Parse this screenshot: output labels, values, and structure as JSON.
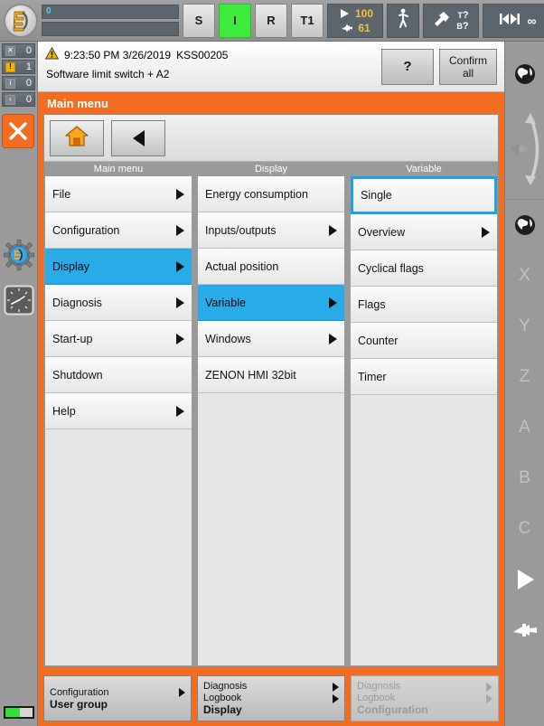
{
  "statusbar": {
    "robot_icon": "kuka-robot-icon",
    "field_top_value": "0",
    "field_bottom_value": "",
    "mode_buttons": [
      {
        "label": "S",
        "active": false
      },
      {
        "label": "I",
        "active": true
      },
      {
        "label": "R",
        "active": false
      },
      {
        "label": "T1",
        "active": false
      }
    ],
    "speed": {
      "program_override": "100",
      "jog_override": "61",
      "program_icon": "play-icon",
      "jog_icon": "hand-icon"
    },
    "walk_icon": "walking-person-icon",
    "tool_base": {
      "icon": "tool-icon",
      "tool_label": "T",
      "tool_value": "?",
      "base_label": "B",
      "base_value": "?"
    },
    "increment_icon": "increment-jog-icon",
    "increment_value": "∞"
  },
  "message": {
    "warning_icon": "warning-triangle-icon",
    "timestamp": "9:23:50 PM 3/26/2019",
    "code": "KSS00205",
    "text": "Software limit switch + A2",
    "help_button": "?",
    "confirm_button": "Confirm all"
  },
  "left_rail": {
    "counters": [
      {
        "icon": "ack-message-icon",
        "value": "0"
      },
      {
        "icon": "warning-icon",
        "value": "1"
      },
      {
        "icon": "info-icon",
        "value": "0"
      },
      {
        "icon": "wait-icon",
        "value": "0"
      }
    ],
    "stop_button": "stop-x-button",
    "gear_icon": "robot-config-gear-icon",
    "clock_icon": "clock-icon",
    "battery_icon": "battery-icon"
  },
  "right_rail": {
    "top": {
      "globe_icon": "world-globe-icon",
      "jog_arrows_icon": "jog-rotate-arrows-icon"
    },
    "bottom": {
      "globe_icon": "world-globe-icon",
      "axes": [
        "X",
        "Y",
        "Z",
        "A",
        "B",
        "C"
      ],
      "play_icon": "play-triangle-icon",
      "hand_icon": "hand-jog-icon"
    }
  },
  "panel": {
    "title": "Main menu",
    "nav": {
      "home_button": "home-icon",
      "back_button": "back-arrow-icon"
    },
    "columns": [
      {
        "header": "Main menu",
        "items": [
          {
            "label": "File",
            "arrow": true,
            "state": "normal"
          },
          {
            "label": "Configuration",
            "arrow": true,
            "state": "normal"
          },
          {
            "label": "Display",
            "arrow": true,
            "state": "selected"
          },
          {
            "label": "Diagnosis",
            "arrow": true,
            "state": "normal"
          },
          {
            "label": "Start-up",
            "arrow": true,
            "state": "normal"
          },
          {
            "label": "Shutdown",
            "arrow": false,
            "state": "normal"
          },
          {
            "label": "Help",
            "arrow": true,
            "state": "normal"
          }
        ]
      },
      {
        "header": "Display",
        "items": [
          {
            "label": "Energy consumption",
            "arrow": false,
            "state": "normal"
          },
          {
            "label": "Inputs/outputs",
            "arrow": true,
            "state": "normal"
          },
          {
            "label": "Actual position",
            "arrow": false,
            "state": "normal"
          },
          {
            "label": "Variable",
            "arrow": true,
            "state": "selected"
          },
          {
            "label": "Windows",
            "arrow": true,
            "state": "normal"
          },
          {
            "label": "ZENON HMI 32bit",
            "arrow": false,
            "state": "normal"
          }
        ]
      },
      {
        "header": "Variable",
        "items": [
          {
            "label": "Single",
            "arrow": false,
            "state": "focused"
          },
          {
            "label": "Overview",
            "arrow": true,
            "state": "normal"
          },
          {
            "label": "Cyclical flags",
            "arrow": false,
            "state": "normal"
          },
          {
            "label": "Flags",
            "arrow": false,
            "state": "normal"
          },
          {
            "label": "Counter",
            "arrow": false,
            "state": "normal"
          },
          {
            "label": "Timer",
            "arrow": false,
            "state": "normal"
          }
        ]
      }
    ]
  },
  "bottom_keys": [
    {
      "enabled": true,
      "lines": [
        {
          "text": "Configuration",
          "bold": false,
          "arrow": true
        },
        {
          "text": "User group",
          "bold": true,
          "arrow": false
        }
      ]
    },
    {
      "enabled": true,
      "lines": [
        {
          "text": "Diagnosis",
          "bold": false,
          "arrow": true
        },
        {
          "text": "Logbook",
          "bold": false,
          "arrow": true
        },
        {
          "text": "Display",
          "bold": true,
          "arrow": false
        }
      ]
    },
    {
      "enabled": false,
      "lines": [
        {
          "text": "Diagnosis",
          "bold": false,
          "arrow": true
        },
        {
          "text": "Logbook",
          "bold": false,
          "arrow": true
        },
        {
          "text": "Configuration",
          "bold": true,
          "arrow": false
        }
      ]
    }
  ],
  "colors": {
    "accent_orange": "#f26d21",
    "selection_blue": "#29abe8",
    "focus_blue": "#1ea2e4",
    "active_green": "#3dea3d",
    "override_yellow": "#f3c142",
    "panel_gray": "#9a9a9a"
  }
}
